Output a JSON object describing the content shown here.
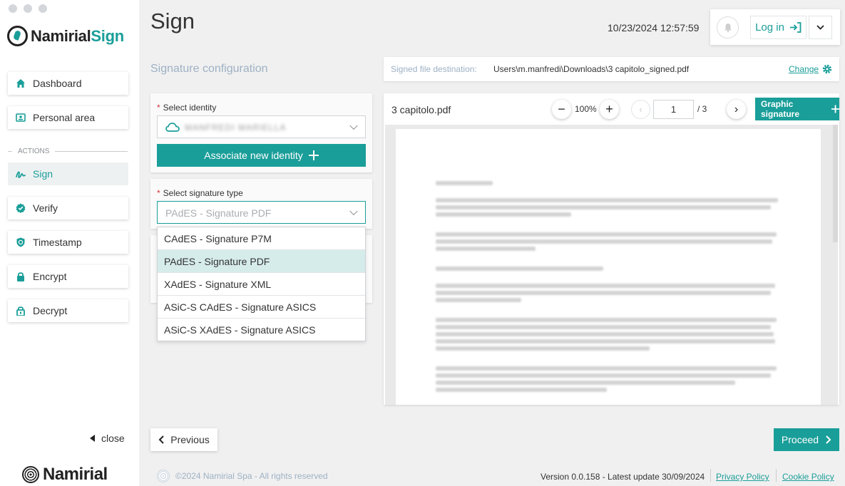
{
  "sidebar": {
    "logo_name": "Namirial",
    "logo_sign": "Sign",
    "items": [
      {
        "label": "Dashboard",
        "icon": "home-icon"
      },
      {
        "label": "Personal area",
        "icon": "id-card-icon"
      },
      {
        "label": "Sign",
        "icon": "signature-icon"
      },
      {
        "label": "Verify",
        "icon": "verified-badge-icon"
      },
      {
        "label": "Timestamp",
        "icon": "shield-clock-icon"
      },
      {
        "label": "Encrypt",
        "icon": "lock-icon"
      },
      {
        "label": "Decrypt",
        "icon": "unlock-icon"
      }
    ],
    "actions_label": "ACTIONS",
    "close_label": "close",
    "footer_logo": "Namirial"
  },
  "header": {
    "title": "Sign",
    "datetime": "10/23/2024 12:57:59",
    "login_label": "Log in"
  },
  "config": {
    "section_title": "Signature configuration",
    "identity_label": "Select identity",
    "identity_value": "MANFREDI MARIELLA",
    "associate_label": "Associate new identity",
    "sigtype_label": "Select signature type",
    "sigtype_value": "PAdES - Signature PDF",
    "options": [
      "CAdES - Signature P7M",
      "PAdES - Signature PDF",
      "XAdES - Signature XML",
      "ASiC-S CAdES - Signature ASICS",
      "ASiC-S XAdES - Signature ASICS"
    ],
    "selected_option_index": 1
  },
  "destination": {
    "label": "Signed file destination:",
    "path": "Users\\m.manfredi\\Downloads\\3 capitolo_signed.pdf",
    "change_label": "Change"
  },
  "viewer": {
    "file_name": "3 capitolo.pdf",
    "zoom": "100%",
    "page": "1",
    "total_pages": "/ 3",
    "graphic_signature_label": "Graphic signature"
  },
  "footer": {
    "previous_label": "Previous",
    "proceed_label": "Proceed",
    "copyright": "©2024 Namirial Spa - All rights reserved",
    "version": "Version 0.0.158 - Latest update 30/09/2024",
    "privacy_label": "Privacy Policy",
    "cookie_label": "Cookie Policy"
  },
  "colors": {
    "accent": "#1a9e99",
    "muted_title": "#9eb1c4",
    "required": "#d0343a"
  }
}
